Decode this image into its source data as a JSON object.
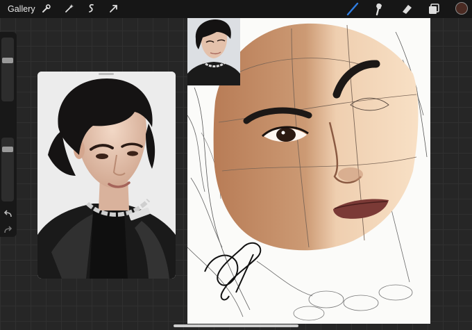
{
  "topbar": {
    "gallery_label": "Gallery",
    "left_tools": [
      "wrench-icon",
      "magic-wand-icon",
      "selection-icon",
      "transform-arrow-icon"
    ],
    "right_tools": [
      "brush-icon",
      "smudge-icon",
      "eraser-icon",
      "layers-icon"
    ],
    "active_tool": "brush-icon",
    "active_color": "#4a2a22",
    "accent_color": "#2f7de1"
  },
  "sidebar": {
    "brush_size_level": 0.65,
    "opacity_level": 0.85
  }
}
